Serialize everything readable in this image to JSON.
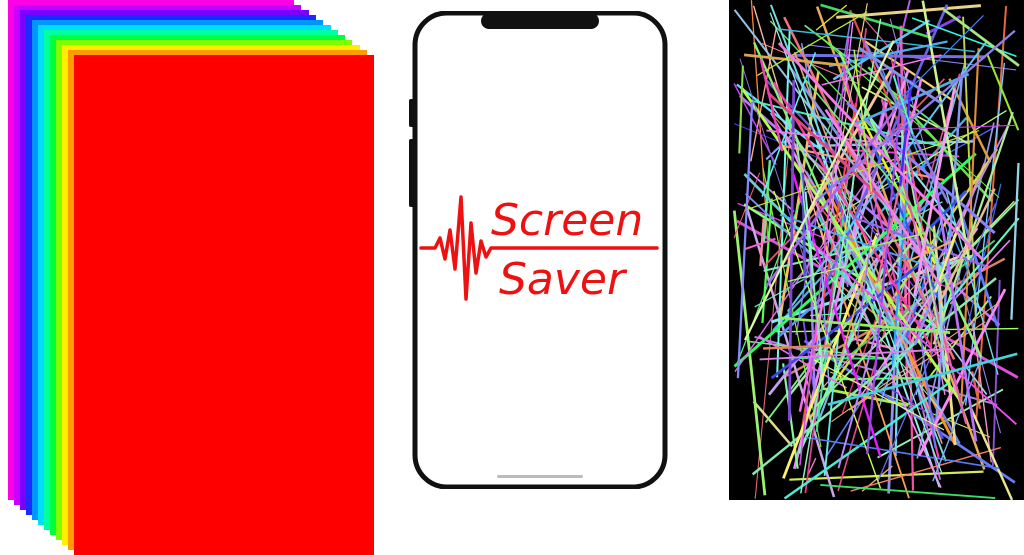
{
  "colors": {
    "sheets": [
      "#ff00e6",
      "#c800ff",
      "#7a00ff",
      "#1a2bff",
      "#0096ff",
      "#00dcff",
      "#00ffa0",
      "#00ff3c",
      "#7dff00",
      "#ffee00",
      "#ff9a00",
      "#ff0000"
    ],
    "brand_red": "#ee1111",
    "phone_frame": "#111111",
    "lines_bg": "#000000"
  },
  "logo": {
    "line1": "Screen",
    "line2": "Saver"
  }
}
